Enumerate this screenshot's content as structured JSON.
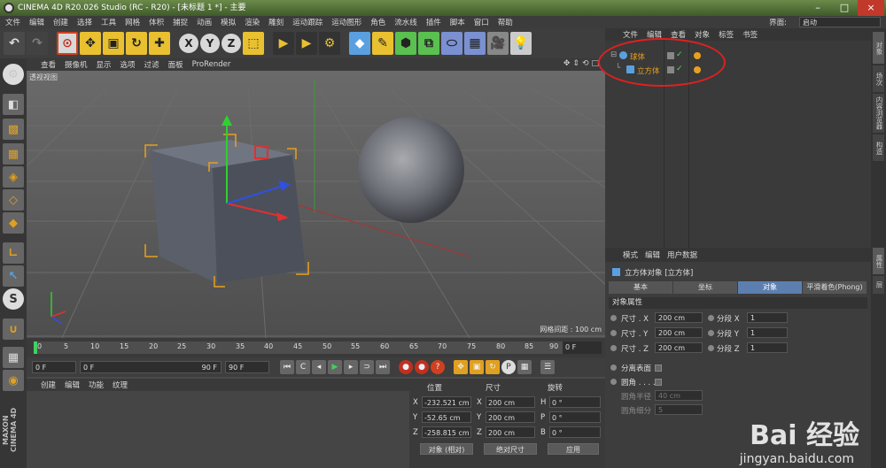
{
  "app": {
    "title": "CINEMA 4D R20.026 Studio (RC - R20) - [未标题 1 *] - 主要",
    "layout_label": "界面:",
    "layout_value": "启动"
  },
  "menu": [
    "文件",
    "编辑",
    "创建",
    "选择",
    "工具",
    "网格",
    "体积",
    "捕捉",
    "动画",
    "模拟",
    "渲染",
    "雕刻",
    "运动跟踪",
    "运动图形",
    "角色",
    "流水线",
    "插件",
    "脚本",
    "窗口",
    "帮助"
  ],
  "toolbar": {
    "axis_x": "X",
    "axis_y": "Y",
    "axis_z": "Z"
  },
  "viewport": {
    "menu": [
      "查看",
      "摄像机",
      "显示",
      "选项",
      "过滤",
      "面板",
      "ProRender"
    ],
    "label": "透视视图",
    "grid_spacing": "网格间距 : 100 cm"
  },
  "timeline": {
    "ticks": [
      "0",
      "5",
      "10",
      "15",
      "20",
      "25",
      "30",
      "35",
      "40",
      "45",
      "50",
      "55",
      "60",
      "65",
      "70",
      "75",
      "80",
      "85",
      "90"
    ],
    "current_frame": "0 F"
  },
  "transport": {
    "start": "0 F",
    "range_start": "0 F",
    "range_end": "90 F",
    "end": "90 F"
  },
  "material": {
    "menu": [
      "创建",
      "编辑",
      "功能",
      "纹理"
    ]
  },
  "coords": {
    "headers": [
      "位置",
      "尺寸",
      "旋转"
    ],
    "rows": [
      {
        "axis": "X",
        "pos": "-232.521 cm",
        "size_axis": "X",
        "size": "200 cm",
        "rot_axis": "H",
        "rot": "0 °"
      },
      {
        "axis": "Y",
        "pos": "-52.65 cm",
        "size_axis": "Y",
        "size": "200 cm",
        "rot_axis": "P",
        "rot": "0 °"
      },
      {
        "axis": "Z",
        "pos": "-258.815 cm",
        "size_axis": "Z",
        "size": "200 cm",
        "rot_axis": "B",
        "rot": "0 °"
      }
    ],
    "mode": "对象 (相对)",
    "size_mode": "绝对尺寸",
    "apply": "应用"
  },
  "object_manager": {
    "menu": [
      "文件",
      "编辑",
      "查看",
      "对象",
      "标签",
      "书签"
    ],
    "objects": [
      {
        "name": "球体",
        "type": "sphere"
      },
      {
        "name": "立方体",
        "type": "cube"
      }
    ]
  },
  "side_tabs": [
    "对象",
    "场次",
    "内容浏览器",
    "构造",
    "属性",
    "层"
  ],
  "attributes": {
    "menu": [
      "模式",
      "编辑",
      "用户数据"
    ],
    "title": "立方体对象 [立方体]",
    "tabs": [
      "基本",
      "坐标",
      "对象",
      "平滑着色(Phong)"
    ],
    "active_tab": "对象",
    "section": "对象属性",
    "size_rows": [
      {
        "label": "尺寸 . X",
        "value": "200 cm",
        "seg_label": "分段 X",
        "seg": "1"
      },
      {
        "label": "尺寸 . Y",
        "value": "200 cm",
        "seg_label": "分段 Y",
        "seg": "1"
      },
      {
        "label": "尺寸 . Z",
        "value": "200 cm",
        "seg_label": "分段 Z",
        "seg": "1"
      }
    ],
    "separate_surfaces": "分离表面",
    "fillet": "圆角 . . . .",
    "fillet_radius_label": "圆角半径",
    "fillet_radius": "40 cm",
    "fillet_subdiv_label": "圆角细分",
    "fillet_subdiv": "5"
  },
  "watermark": {
    "brand": "Bai 经验",
    "url": "jingyan.baidu.com"
  },
  "colors": {
    "accent_blue": "#5c7fb0",
    "highlight_orange": "#e8a020",
    "annotation_red": "#e02020"
  }
}
